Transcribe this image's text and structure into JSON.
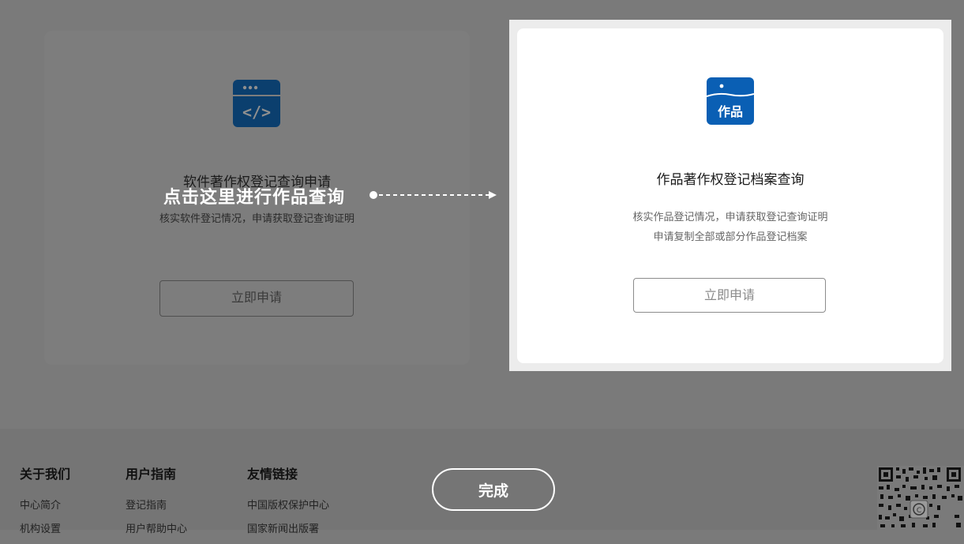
{
  "software_card": {
    "title": "软件著作权登记查询申请",
    "description": "核实软件登记情况，申请获取登记查询证明",
    "apply_label": "立即申请",
    "icon": "code-window-icon"
  },
  "hint": {
    "text": "点击这里进行作品查询"
  },
  "works_card": {
    "title": "作品著作权登记档案查询",
    "description_line1": "核实作品登记情况，申请获取登记查询证明",
    "description_line2": "申请复制全部或部分作品登记档案",
    "apply_label": "立即申请",
    "icon_label": "作品",
    "icon": "works-badge-icon"
  },
  "footer": {
    "columns": [
      {
        "heading": "关于我们",
        "links": [
          "中心简介",
          "机构设置"
        ]
      },
      {
        "heading": "用户指南",
        "links": [
          "登记指南",
          "用户帮助中心"
        ]
      },
      {
        "heading": "友情链接",
        "links": [
          "中国版权保护中心",
          "国家新闻出版署"
        ]
      }
    ],
    "qr_icon": "qr-code-icon"
  },
  "overlay": {
    "done_label": "完成"
  },
  "colors": {
    "brand_blue": "#0a5fb4",
    "overlay_gray": "#7a7a7a",
    "card_white": "#ffffff"
  }
}
